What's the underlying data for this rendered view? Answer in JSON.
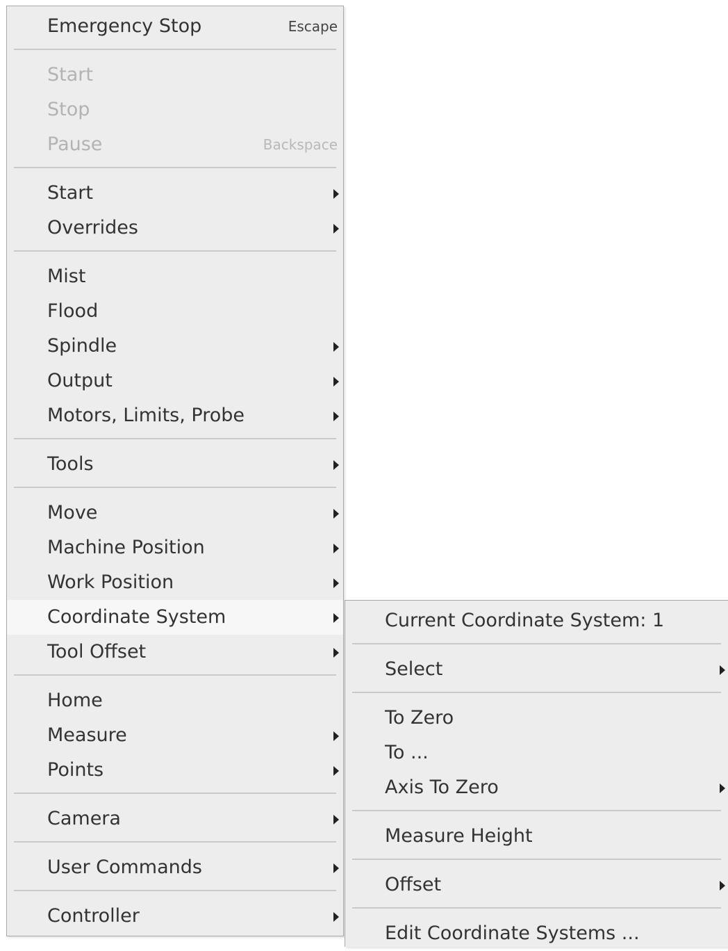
{
  "main_menu": {
    "emergency_stop": {
      "label": "Emergency Stop",
      "shortcut": "Escape"
    },
    "start_disabled": {
      "label": "Start"
    },
    "stop_disabled": {
      "label": "Stop"
    },
    "pause_disabled": {
      "label": "Pause",
      "shortcut": "Backspace"
    },
    "start": {
      "label": "Start"
    },
    "overrides": {
      "label": "Overrides"
    },
    "mist": {
      "label": "Mist"
    },
    "flood": {
      "label": "Flood"
    },
    "spindle": {
      "label": "Spindle"
    },
    "output": {
      "label": "Output"
    },
    "motors": {
      "label": "Motors, Limits, Probe"
    },
    "tools": {
      "label": "Tools"
    },
    "move": {
      "label": "Move"
    },
    "machine_position": {
      "label": "Machine Position"
    },
    "work_position": {
      "label": "Work Position"
    },
    "coordinate_system": {
      "label": "Coordinate System"
    },
    "tool_offset": {
      "label": "Tool Offset"
    },
    "home": {
      "label": "Home"
    },
    "measure": {
      "label": "Measure"
    },
    "points": {
      "label": "Points"
    },
    "camera": {
      "label": "Camera"
    },
    "user_commands": {
      "label": "User Commands"
    },
    "controller": {
      "label": "Controller"
    }
  },
  "coordinate_submenu": {
    "current": {
      "label": "Current Coordinate System: 1"
    },
    "select": {
      "label": "Select"
    },
    "to_zero": {
      "label": "To Zero"
    },
    "to": {
      "label": "To ..."
    },
    "axis_to_zero": {
      "label": "Axis To Zero"
    },
    "measure_height": {
      "label": "Measure Height"
    },
    "offset": {
      "label": "Offset"
    },
    "edit": {
      "label": "Edit Coordinate Systems ..."
    }
  },
  "colors": {
    "menu_background": "#ededed",
    "highlight": "#f7f7f7",
    "text": "#333333",
    "disabled_text": "#b3b3b3",
    "separator": "#c9c9c9"
  },
  "icons": {
    "submenu_arrow": "submenu-arrow-icon"
  }
}
